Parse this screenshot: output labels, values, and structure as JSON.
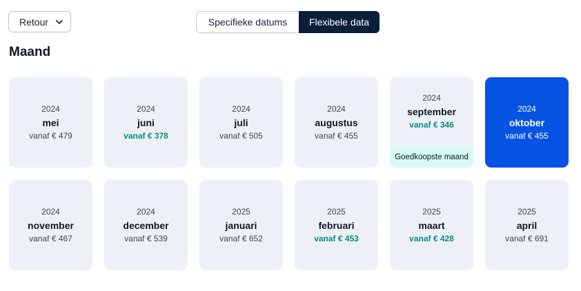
{
  "trip_type": {
    "value": "Retour",
    "icon": "chevron-down-icon"
  },
  "date_mode": {
    "specific_label": "Specifieke datums",
    "flexible_label": "Flexibele data",
    "selected": "flexible"
  },
  "section_title": "Maand",
  "badge_label": "Goedkoopste maand",
  "colors": {
    "selected": "#0552e3",
    "cheap_price": "#0b8a80",
    "badge_bg": "#d6faf1",
    "card_bg": "#edf1f7",
    "toggle_active": "#0b1e3a"
  },
  "months": [
    {
      "year": "2024",
      "month": "mei",
      "price": "vanaf € 479",
      "cheap": false,
      "selected": false,
      "badge": false
    },
    {
      "year": "2024",
      "month": "juni",
      "price": "vanaf € 378",
      "cheap": true,
      "selected": false,
      "badge": false
    },
    {
      "year": "2024",
      "month": "juli",
      "price": "vanaf € 505",
      "cheap": false,
      "selected": false,
      "badge": false
    },
    {
      "year": "2024",
      "month": "augustus",
      "price": "vanaf € 455",
      "cheap": false,
      "selected": false,
      "badge": false
    },
    {
      "year": "2024",
      "month": "september",
      "price": "vanaf € 346",
      "cheap": true,
      "selected": false,
      "badge": true
    },
    {
      "year": "2024",
      "month": "oktober",
      "price": "vanaf € 455",
      "cheap": false,
      "selected": true,
      "badge": false
    },
    {
      "year": "2024",
      "month": "november",
      "price": "vanaf € 467",
      "cheap": false,
      "selected": false,
      "badge": false
    },
    {
      "year": "2024",
      "month": "december",
      "price": "vanaf € 539",
      "cheap": false,
      "selected": false,
      "badge": false
    },
    {
      "year": "2025",
      "month": "januari",
      "price": "vanaf € 652",
      "cheap": false,
      "selected": false,
      "badge": false
    },
    {
      "year": "2025",
      "month": "februari",
      "price": "vanaf € 453",
      "cheap": true,
      "selected": false,
      "badge": false
    },
    {
      "year": "2025",
      "month": "maart",
      "price": "vanaf € 428",
      "cheap": true,
      "selected": false,
      "badge": false
    },
    {
      "year": "2025",
      "month": "april",
      "price": "vanaf € 691",
      "cheap": false,
      "selected": false,
      "badge": false
    }
  ]
}
